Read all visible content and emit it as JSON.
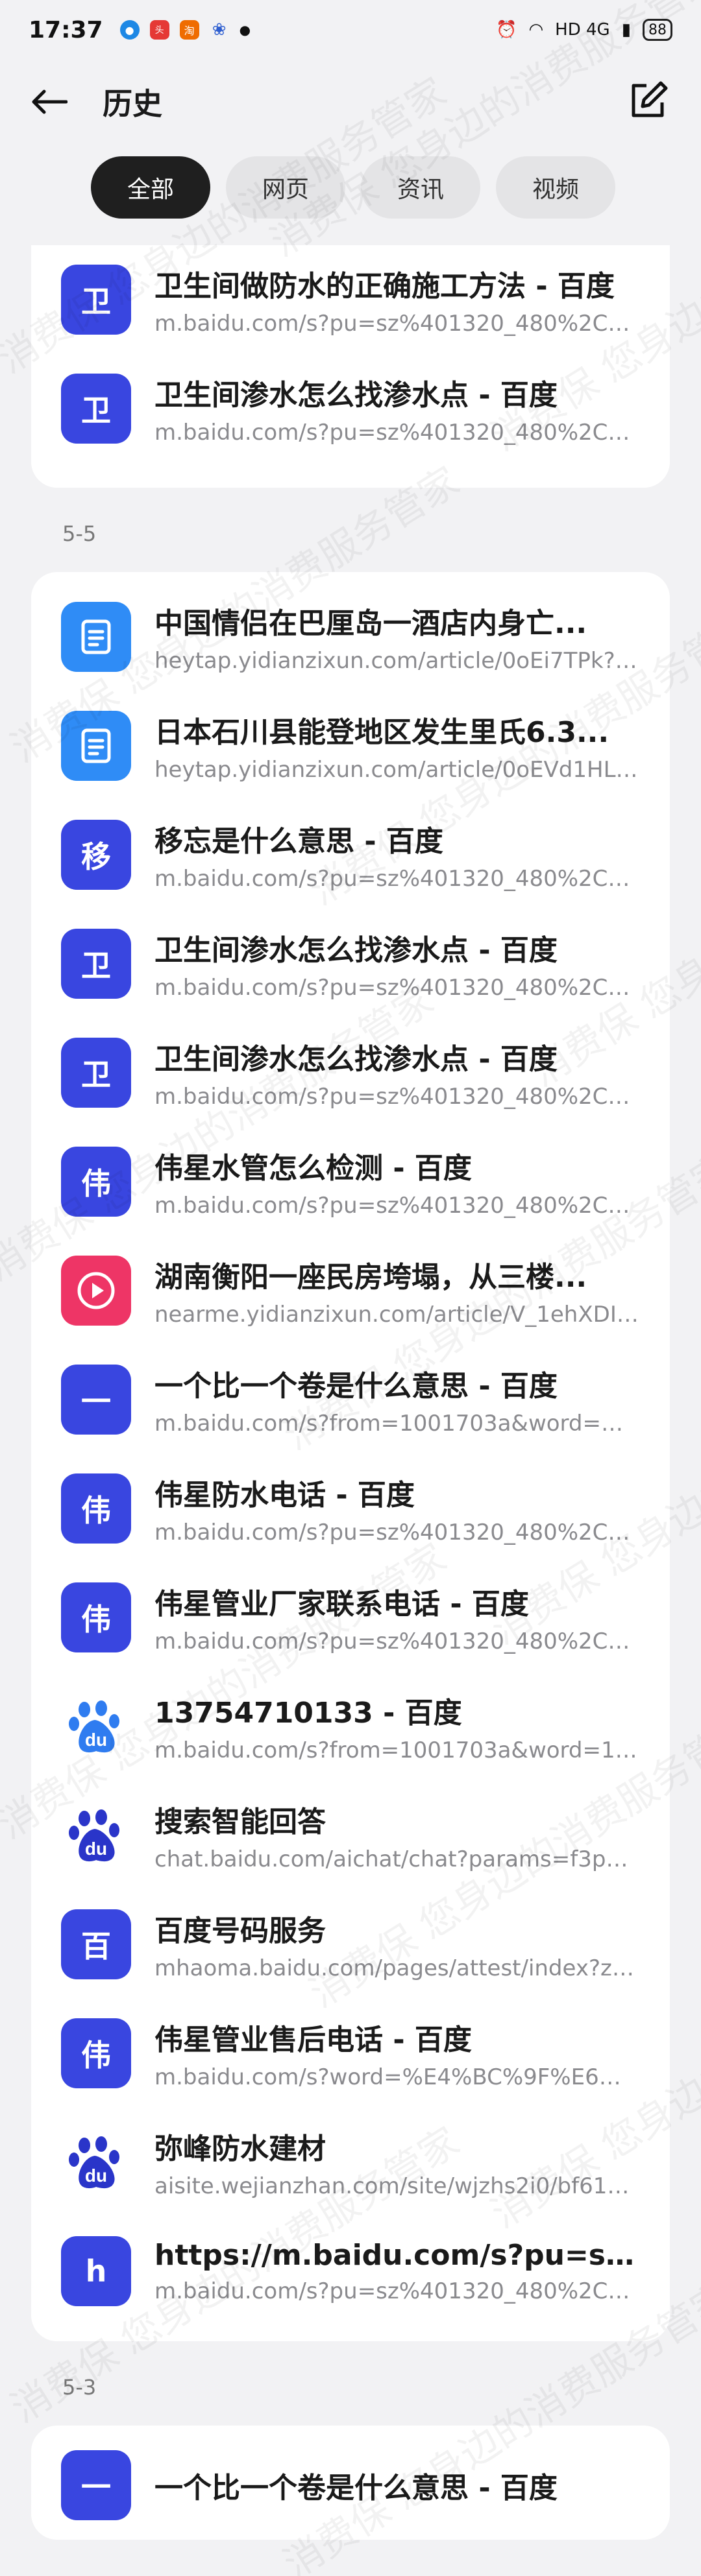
{
  "status": {
    "time": "17:37",
    "battery": "88",
    "right_text": "HD 4G"
  },
  "header": {
    "title": "历史"
  },
  "tabs": [
    "全部",
    "网页",
    "资讯",
    "视频"
  ],
  "groups": [
    {
      "label": "",
      "items": [
        {
          "icon": "卫",
          "color": "blue",
          "title": "卫生间做防水的正确施工方法 - 百度",
          "url": "m.baidu.com/s?pu=sz%401320_480%2Ccuid..."
        },
        {
          "icon": "卫",
          "color": "blue",
          "title": "卫生间渗水怎么找渗水点 - 百度",
          "url": "m.baidu.com/s?pu=sz%401320_480%2Ccuid..."
        }
      ]
    },
    {
      "label": "5-5",
      "items": [
        {
          "icon": "doc",
          "color": "sky",
          "title": "中国情侣在巴厘岛一酒店内身亡...",
          "url": "heytap.yidianzixun.com/article/0oEi7TPk?fr..."
        },
        {
          "icon": "doc",
          "color": "sky",
          "title": "日本石川县能登地区发生里氏6.3...",
          "url": "heytap.yidianzixun.com/article/0oEVd1HL?f..."
        },
        {
          "icon": "移",
          "color": "blue",
          "title": "移忘是什么意思 - 百度",
          "url": "m.baidu.com/s?pu=sz%401320_480%2Ccuid..."
        },
        {
          "icon": "卫",
          "color": "blue",
          "title": "卫生间渗水怎么找渗水点 - 百度",
          "url": "m.baidu.com/s?pu=sz%401320_480%2Ccuid..."
        },
        {
          "icon": "卫",
          "color": "blue",
          "title": "卫生间渗水怎么找渗水点 - 百度",
          "url": "m.baidu.com/s?pu=sz%401320_480%2Ccuid..."
        },
        {
          "icon": "伟",
          "color": "blue",
          "title": "伟星水管怎么检测 - 百度",
          "url": "m.baidu.com/s?pu=sz%401320_480%2Ccuid..."
        },
        {
          "icon": "play",
          "color": "pink",
          "title": "湖南衡阳一座民房垮塌，从三楼...",
          "url": "nearme.yidianzixun.com/article/V_1ehXDI6n..."
        },
        {
          "icon": "一",
          "color": "blue",
          "title": "一个比一个卷是什么意思 - 百度",
          "url": "m.baidu.com/s?from=1001703a&word=%E4..."
        },
        {
          "icon": "伟",
          "color": "blue",
          "title": "伟星防水电话 - 百度",
          "url": "m.baidu.com/s?pu=sz%401320_480%2Ccuid..."
        },
        {
          "icon": "伟",
          "color": "blue",
          "title": "伟星管业厂家联系电话 - 百度",
          "url": "m.baidu.com/s?pu=sz%401320_480%2Ccuid..."
        },
        {
          "icon": "paw-light",
          "color": "paw",
          "title": "13754710133 - 百度",
          "url": "m.baidu.com/s?from=1001703a&word=137..."
        },
        {
          "icon": "paw-dark",
          "color": "paw",
          "title": "搜索智能回答",
          "url": "chat.baidu.com/aichat/chat?params=f3pR2..."
        },
        {
          "icon": "百",
          "color": "blue",
          "title": "百度号码服务",
          "url": "mhaoma.baidu.com/pages/attest/index?zd..."
        },
        {
          "icon": "伟",
          "color": "blue",
          "title": "伟星管业售后电话 - 百度",
          "url": "m.baidu.com/s?word=%E4%BC%9F%E6%98..."
        },
        {
          "icon": "paw-dark",
          "color": "paw",
          "title": "弥峰防水建材",
          "url": "aisite.wejianzhan.com/site/wjzhs2i0/bf616..."
        },
        {
          "icon": "h",
          "color": "blue",
          "title": "https://m.baidu.com/s?pu=sz%4...",
          "url": "m.baidu.com/s?pu=sz%401320_480%2Ccuid..."
        }
      ]
    },
    {
      "label": "5-3",
      "items": [
        {
          "icon": "一",
          "color": "blue",
          "title": "一个比一个卷是什么意思 - 百度",
          "url": ""
        }
      ]
    }
  ],
  "colors": {
    "blue": "#3946e0",
    "sky": "#2f8cf6",
    "pink": "#ee3566",
    "tab_active": "#1f1f1f"
  },
  "watermark": "消费保 您身边的消费服务管家"
}
